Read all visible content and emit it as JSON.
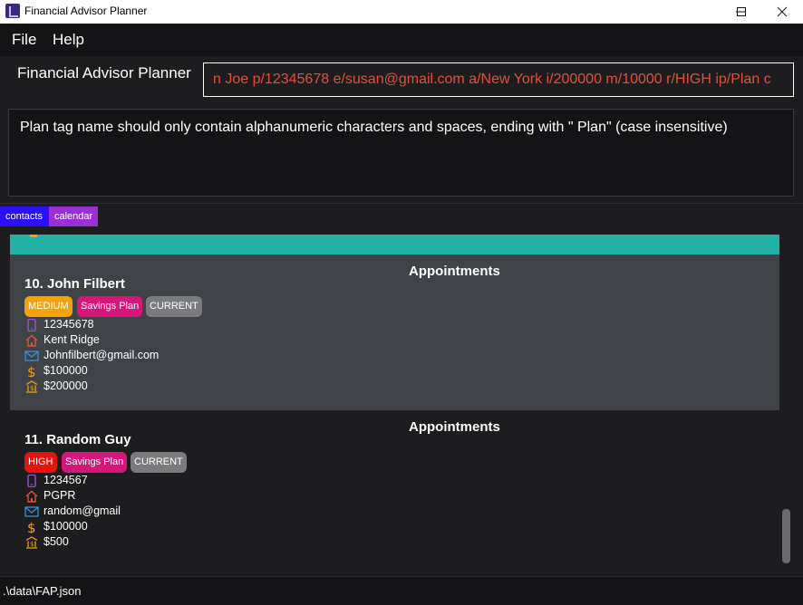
{
  "window": {
    "title": "Financial Advisor Planner",
    "minimize_glyph": "—",
    "maximize_glyph": "☐",
    "close_glyph": "✕"
  },
  "menu": {
    "items": [
      "File",
      "Help"
    ]
  },
  "header": {
    "label": "Financial Advisor Planner",
    "command_value": "n Joe p/12345678 e/susan@gmail.com a/New York i/200000 m/10000 r/HIGH ip/Plan c"
  },
  "result": {
    "message": "Plan tag name should only contain alphanumeric characters and spaces, ending with \" Plan\" (case insensitive)"
  },
  "tabs": [
    {
      "label": "contacts",
      "color": "#2b10ff"
    },
    {
      "label": "calendar",
      "color": "#9b2fd6"
    }
  ],
  "persons": [
    {
      "index_name": "10.  John Filbert",
      "appointments_label": "Appointments",
      "tags": [
        {
          "label": "MEDIUM",
          "color": "#f4a20a"
        },
        {
          "label": "Savings Plan",
          "color": "#d6177a"
        },
        {
          "label": "CURRENT",
          "color": "#7b7b7e"
        }
      ],
      "phone": "12345678",
      "address": "Kent Ridge",
      "email": "Johnfilbert@gmail.com",
      "income": "$100000",
      "monthly": "$200000"
    },
    {
      "index_name": "11.  Random Guy",
      "appointments_label": "Appointments",
      "tags": [
        {
          "label": "HIGH",
          "color": "#e5140d"
        },
        {
          "label": "Savings Plan",
          "color": "#d6177a"
        },
        {
          "label": "CURRENT",
          "color": "#7b7b7e"
        }
      ],
      "phone": "1234567",
      "address": "PGPR",
      "email": "random@gmail",
      "income": "$100000",
      "monthly": "$500"
    }
  ],
  "icons": {
    "phone": "phone-icon",
    "address": "home-icon",
    "email": "mail-icon",
    "income": "dollar-icon",
    "monthly": "bank-icon"
  },
  "colors": {
    "teal_header": "#22b2a6",
    "alt_card": "#3f4347",
    "command_text": "#e2503b"
  },
  "status": {
    "path": ".\\data\\FAP.json"
  }
}
